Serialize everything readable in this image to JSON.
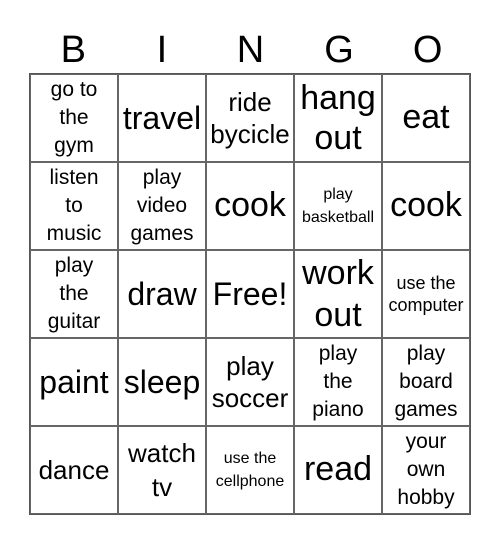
{
  "header": [
    "B",
    "I",
    "N",
    "G",
    "O"
  ],
  "cells": [
    "go to the gym",
    "travel",
    "ride bycicle",
    "hang out",
    "eat",
    "listen to music",
    "play video games",
    "cook",
    "play basketball",
    "cook",
    "play the guitar",
    "draw",
    "Free!",
    "work out",
    "use the computer",
    "paint",
    "sleep",
    "play soccer",
    "play the piano",
    "play board games",
    "dance",
    "watch tv",
    "use the cellphone",
    "read",
    "your own hobby"
  ]
}
